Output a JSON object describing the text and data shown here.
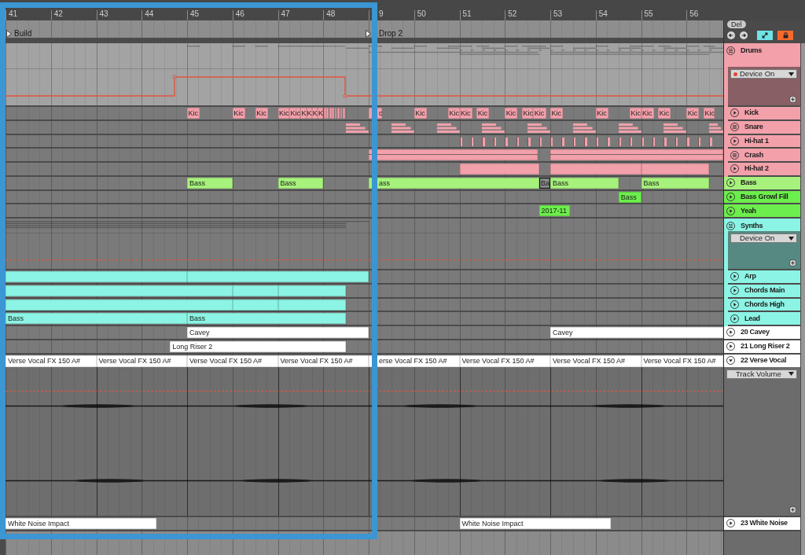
{
  "ruler": {
    "bars": [
      "41",
      "42",
      "43",
      "44",
      "45",
      "46",
      "47",
      "48",
      "9",
      "50",
      "51",
      "52",
      "53",
      "54",
      "55",
      "56"
    ]
  },
  "locators": [
    {
      "name": "Build"
    },
    {
      "name": "Drop 2"
    }
  ],
  "controls": {
    "delete_button": "Del"
  },
  "tracks": [
    {
      "name": "Drums",
      "kind": "group",
      "color": "#f2a0aa",
      "expanded": true,
      "automation": {
        "parameter": "Device On",
        "automated": true
      },
      "children": [
        {
          "name": "Kick",
          "kind": "track",
          "color": "#f2a0aa",
          "expanded": false,
          "clips": [
            {
              "label": "Kic"
            },
            {
              "label": "Kic"
            },
            {
              "label": "Kic"
            },
            {
              "label": "Kic"
            },
            {
              "label": "Kic"
            },
            {
              "label": "K"
            },
            {
              "label": "K"
            },
            {
              "label": "K"
            },
            {
              "label": "K"
            },
            {
              "label": "c"
            },
            {
              "label": "Kic"
            },
            {
              "label": "Kic"
            },
            {
              "label": "Kic"
            },
            {
              "label": "Kic"
            },
            {
              "label": "Kic"
            },
            {
              "label": "Kic"
            },
            {
              "label": "Kic"
            },
            {
              "label": "Kic"
            },
            {
              "label": "Kic"
            },
            {
              "label": "Kic"
            },
            {
              "label": "Kic"
            },
            {
              "label": "Kic"
            },
            {
              "label": "Kic"
            },
            {
              "label": "Kic"
            }
          ]
        },
        {
          "name": "Snare",
          "kind": "stack",
          "color": "#f2a0aa",
          "expanded": false
        },
        {
          "name": "Hi-hat 1",
          "kind": "track",
          "color": "#f2a0aa",
          "expanded": false
        },
        {
          "name": "Crash",
          "kind": "stack",
          "color": "#f2a0aa",
          "expanded": false
        },
        {
          "name": "Hi-hat 2",
          "kind": "track",
          "color": "#f2a0aa",
          "expanded": false
        }
      ]
    },
    {
      "name": "Bass",
      "kind": "track",
      "color": "#a6f27c",
      "expanded": false,
      "clips": [
        {
          "label": "Bass",
          "active": true
        },
        {
          "label": "Bass",
          "active": true
        },
        {
          "label": "ass",
          "active": true
        },
        {
          "label": "Ba",
          "active": false
        },
        {
          "label": "Bass",
          "active": true
        },
        {
          "label": "Bass",
          "active": true
        }
      ]
    },
    {
      "name": "Bass Growl Fill",
      "kind": "track",
      "color": "#6cee4c",
      "expanded": false,
      "clips": [
        {
          "label": "Bass"
        }
      ]
    },
    {
      "name": "Yeah",
      "kind": "track",
      "color": "#6cee4c",
      "expanded": false,
      "clips": [
        {
          "label": "2017-11"
        }
      ]
    },
    {
      "name": "Synths",
      "kind": "group",
      "color": "#8cf4e4",
      "expanded": true,
      "automation": {
        "parameter": "Device On",
        "automated": false
      },
      "children": [
        {
          "name": "Arp",
          "kind": "track",
          "color": "#8cf4e4",
          "expanded": false
        },
        {
          "name": "Chords Main",
          "kind": "track",
          "color": "#8cf4e4",
          "expanded": false
        },
        {
          "name": "Chords High",
          "kind": "track",
          "color": "#8cf4e4",
          "expanded": false
        },
        {
          "name": "Lead",
          "kind": "track",
          "color": "#8cf4e4",
          "expanded": false,
          "clips": [
            {
              "label": "Bass"
            },
            {
              "label": "Bass"
            }
          ]
        }
      ]
    },
    {
      "name": "20 Cavey",
      "kind": "track",
      "color": "#ffffff",
      "expanded": false,
      "clips": [
        {
          "label": "Cavey"
        },
        {
          "label": "Cavey"
        }
      ]
    },
    {
      "name": "21 Long Riser 2",
      "kind": "track",
      "color": "#ffffff",
      "expanded": false,
      "clips": [
        {
          "label": "Long Riser 2"
        }
      ]
    },
    {
      "name": "22 Verse Vocal",
      "kind": "track",
      "color": "#ffffff",
      "expanded": true,
      "automation": {
        "parameter": "Track Volume",
        "automated": false
      },
      "clips": [
        {
          "label": "Verse Vocal FX 150 A#"
        },
        {
          "label": "Verse Vocal FX 150 A#"
        },
        {
          "label": "Verse Vocal FX 150 A#"
        },
        {
          "label": "Verse Vocal FX 150 A#"
        },
        {
          "label": "erse Vocal FX 150 A#"
        },
        {
          "label": "Verse Vocal FX 150 A#"
        },
        {
          "label": "Verse Vocal FX 150 A#"
        },
        {
          "label": "Verse Vocal FX 150 A#"
        }
      ]
    },
    {
      "name": "23 White Noise",
      "kind": "track",
      "color": "#ffffff",
      "expanded": false,
      "clips": [
        {
          "label": "White Noise Impact"
        },
        {
          "label": "White Noise Impact"
        }
      ]
    }
  ]
}
